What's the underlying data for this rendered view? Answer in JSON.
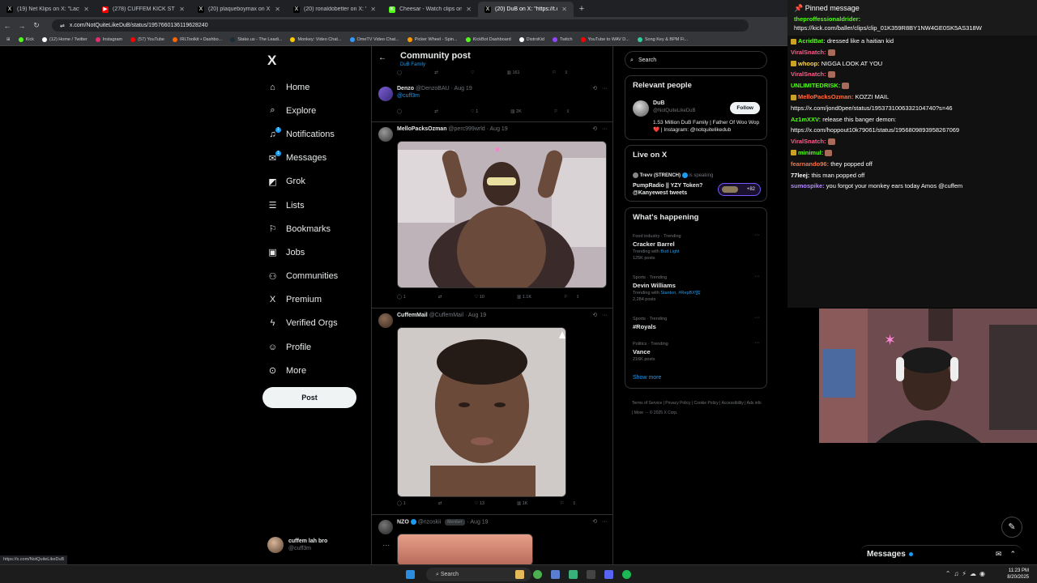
{
  "browser": {
    "tabs": [
      {
        "label": "(19) Net Klips on X: \"Lacy's girl",
        "color": "#000000",
        "glyph": "X"
      },
      {
        "label": "(278) CUFFEM KICK STREAM 8/",
        "color": "#ff0000",
        "glyph": "▶"
      },
      {
        "label": "(20) plaqueboymax on X: \"I'M",
        "color": "#000000",
        "glyph": "X"
      },
      {
        "label": "(20) ronaldobetter on X: \"@cuff",
        "color": "#000000",
        "glyph": "X"
      },
      {
        "label": "Cheesar - Watch clips on Kick",
        "color": "#53fc18",
        "glyph": "K"
      },
      {
        "label": "(20) DuB on X: \"https://t.co/Ri",
        "color": "#000000",
        "glyph": "X",
        "active": true
      }
    ],
    "url": "x.com/NotQuiteLikeDuB/status/1957660136119628240",
    "bookmarks": [
      {
        "label": "Kick",
        "color": "#53fc18"
      },
      {
        "label": "(12) Home / Twitter",
        "color": "#ffffff"
      },
      {
        "label": "Instagram",
        "color": "#e1306c"
      },
      {
        "label": "(57) YouTube",
        "color": "#ff0000"
      },
      {
        "label": "IRLToolkit • Dashbo...",
        "color": "#ff6600"
      },
      {
        "label": "Stake.us - The Leadi...",
        "color": "#1a2c38"
      },
      {
        "label": "Monkey: Video Chat...",
        "color": "#ffcc00"
      },
      {
        "label": "OmeTV Video Chat...",
        "color": "#3399ff"
      },
      {
        "label": "Picker Wheel - Spin...",
        "color": "#ff9900"
      },
      {
        "label": "KickBot Dashboard",
        "color": "#53fc18"
      },
      {
        "label": "DistroKid",
        "color": "#ffffff"
      },
      {
        "label": "Twitch",
        "color": "#9146ff"
      },
      {
        "label": "YouTube to WAV D...",
        "color": "#ff0000"
      },
      {
        "label": "Song Key & BPM Fi...",
        "color": "#33cc99"
      }
    ],
    "all_bookmarks": "All Bookmarks",
    "status_url": "https://x.com/NotQuiteLikeDuB"
  },
  "nav": {
    "logo": "X",
    "items": [
      {
        "label": "Home",
        "icon": "home-icon",
        "glyph": "⌂"
      },
      {
        "label": "Explore",
        "icon": "search-icon",
        "glyph": "⌕"
      },
      {
        "label": "Notifications",
        "icon": "bell-icon",
        "glyph": "♫",
        "badge": "1"
      },
      {
        "label": "Messages",
        "icon": "mail-icon",
        "glyph": "✉",
        "badge": "1"
      },
      {
        "label": "Grok",
        "icon": "grok-icon",
        "glyph": "◩"
      },
      {
        "label": "Lists",
        "icon": "list-icon",
        "glyph": "☰"
      },
      {
        "label": "Bookmarks",
        "icon": "bookmark-icon",
        "glyph": "⚐"
      },
      {
        "label": "Jobs",
        "icon": "briefcase-icon",
        "glyph": "▣"
      },
      {
        "label": "Communities",
        "icon": "people-icon",
        "glyph": "⚇"
      },
      {
        "label": "Premium",
        "icon": "x-icon",
        "glyph": "X"
      },
      {
        "label": "Verified Orgs",
        "icon": "bolt-icon",
        "glyph": "ϟ"
      },
      {
        "label": "Profile",
        "icon": "person-icon",
        "glyph": "☺"
      },
      {
        "label": "More",
        "icon": "more-circle-icon",
        "glyph": "⊙"
      }
    ],
    "post_label": "Post",
    "account": {
      "name": "cuffem lah bro",
      "handle": "@cuff3m",
      "more": "···"
    }
  },
  "feed": {
    "title": "Community post",
    "subtitle": "DuB Family",
    "top_actions": {
      "views": "161"
    },
    "posts": [
      {
        "name": "Denzo",
        "handle": "@DenzoBAU",
        "date": "· Aug 19",
        "text": "@cuff3m",
        "replies": "",
        "likes": "1",
        "views": "2K"
      },
      {
        "name": "MelloPacksOzman",
        "handle": "@perc999wrld",
        "date": "· Aug 19",
        "replies": "1",
        "likes": "10",
        "views": "1.1K"
      },
      {
        "name": "CuffemMail",
        "handle": "@CuffemMail",
        "date": "· Aug 19",
        "replies": "1",
        "likes": "13",
        "views": "1K"
      },
      {
        "name": "NZO",
        "handle": "@nzoskii",
        "badge": "Member",
        "date": "· Aug 19"
      }
    ]
  },
  "right": {
    "search_placeholder": "Search",
    "relevant": {
      "title": "Relevant people",
      "name": "DuB",
      "handle": "@NotQuiteLikeDuB",
      "follow": "Follow",
      "bio": "1.53 Million DuB Family | Father Of Woo Wop❤️ | Instagram: @notquitelikedub"
    },
    "live": {
      "title": "Live on X",
      "host": "Trevv (STRENCH)",
      "status": "is speaking",
      "space": "PumpRadio || YZY Token? @Kanyewest tweets",
      "count": "+82"
    },
    "happening": {
      "title": "What's happening",
      "trends": [
        {
          "category": "Food industry · Trending",
          "title": "Cracker Barrel",
          "with": "Trending with",
          "with_links": "Bud Light",
          "count": "125K posts"
        },
        {
          "category": "Sports · Trending",
          "title": "Devin Williams",
          "with": "Trending with",
          "with_links": "Stanton, #RepBX🏗",
          "count": "2,284 posts"
        },
        {
          "category": "Sports · Trending",
          "title": "#Royals"
        },
        {
          "category": "Politics · Trending",
          "title": "Vance",
          "count": "216K posts"
        }
      ],
      "show_more": "Show more"
    },
    "footer": "Terms of Service | Privacy Policy | Cookie Policy | Accessibility | Ads info | More ··· © 2025 X Corp."
  },
  "chat": {
    "pinned_title": "Pinned message",
    "pinned_user": "theproffessionaldrider:",
    "pinned_msg": "https://kick.com/baller/clips/clip_01K359R8BY1NW4GE0SK5AS318W",
    "messages": [
      {
        "user": "AcridBat:",
        "text": "dressed like a haitian kid",
        "color": "#53fc18",
        "badge": true
      },
      {
        "user": "ViralSnatch:",
        "text": "",
        "color": "#ff5c8a",
        "emote": true
      },
      {
        "user": "whoop:",
        "text": "NIGGA LOOK AT YOU",
        "color": "#ffd54f",
        "badge": true
      },
      {
        "user": "ViralSnatch:",
        "text": "",
        "color": "#ff5c8a",
        "emote": true
      },
      {
        "user": "UNLIMITEDRISK:",
        "text": "",
        "color": "#53fc18",
        "emote": true
      },
      {
        "user": "MelloPacksOzman:",
        "text": "KOZZI MAIL",
        "color": "#ff6e40",
        "badge": true
      },
      {
        "user": "",
        "text": "https://x.com/jond0pee/status/1953731006332104740?s=46",
        "color": "#ffffff"
      },
      {
        "user": "Az1mXXV:",
        "text": "release this banger demon:",
        "color": "#53fc18"
      },
      {
        "user": "",
        "text": "https://x.com/hoppout10k79061/status/1956809893958267069",
        "color": "#ffffff"
      },
      {
        "user": "ViralSnatch:",
        "text": "",
        "color": "#ff5c8a",
        "emote": true
      },
      {
        "user": "minimul:",
        "text": "",
        "color": "#53fc18",
        "emote": true,
        "badge": true
      },
      {
        "user": "fearnando96:",
        "text": "they popped off",
        "color": "#ff7043"
      },
      {
        "user": "77leej:",
        "text": "this man popped off",
        "color": "#ffffff"
      },
      {
        "user": "sumospike:",
        "text": "you forgot your monkey ears today Amos @cuffem",
        "color": "#b388ff"
      }
    ]
  },
  "overlay": {
    "messages_label": "Messages"
  },
  "taskbar": {
    "search": "Search",
    "time": "11:23 PM",
    "date": "8/20/2025"
  }
}
